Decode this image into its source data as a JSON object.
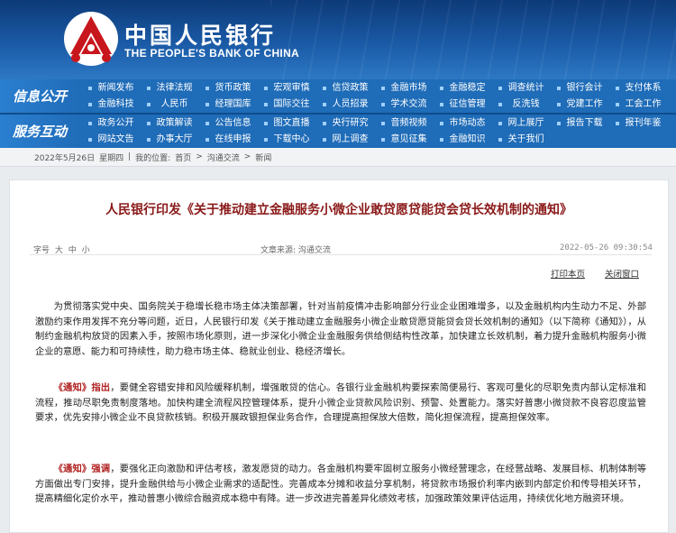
{
  "header": {
    "bank_name_cn": "中国人民银行",
    "bank_name_en": "THE PEOPLE'S BANK OF CHINA",
    "logo_icon": "pboc-logo-icon",
    "color_primary": "#1f6cb8",
    "color_title": "#8b1a1a"
  },
  "nav": {
    "info_label": "信息公开",
    "service_label": "服务互动",
    "rows": [
      [
        "新闻发布",
        "法律法规",
        "货币政策",
        "宏观审慎",
        "信贷政策",
        "金融市场",
        "金融稳定",
        "调查统计",
        "银行会计",
        "支付体系"
      ],
      [
        "金融科技",
        "人民币",
        "经理国库",
        "国际交往",
        "人员招录",
        "学术交流",
        "征信管理",
        "反洗钱",
        "党建工作",
        "工会工作"
      ],
      [
        "政务公开",
        "政策解读",
        "公告信息",
        "图文直播",
        "央行研究",
        "音频视频",
        "市场动态",
        "网上展厅",
        "报告下载",
        "报刊年鉴"
      ],
      [
        "网站文告",
        "办事大厅",
        "在线申报",
        "下载中心",
        "网上调查",
        "意见征集",
        "金融知识",
        "关于我们"
      ]
    ]
  },
  "breadcrumb": {
    "date": "2022年5月26日",
    "weekday": "星期四",
    "location_label": "我的位置:",
    "items": [
      "首页",
      "沟通交流",
      "新闻"
    ],
    "separator": ">"
  },
  "article": {
    "title": "人民银行印发《关于推动建立金融服务小微企业敢贷愿贷能贷会贷长效机制的通知》",
    "font_size_label": "字号",
    "font_sizes": [
      "大",
      "中",
      "小"
    ],
    "source_label": "文章来源:",
    "source": "沟通交流",
    "datetime": "2022-05-26  09:30:54",
    "print_label": "打印本页",
    "close_label": "关闭窗口",
    "paragraphs": [
      {
        "highlight": "",
        "text": "为贯彻落实党中央、国务院关于稳增长稳市场主体决策部署，针对当前疫情冲击影响部分行业企业困难增多，以及金融机构内生动力不足、外部激励约束作用发挥不充分等问题，近日，人民银行印发《关于推动建立金融服务小微企业敢贷愿贷能贷会贷长效机制的通知》（以下简称《通知》），从制约金融机构放贷的因素入手，按照市场化原则，进一步深化小微企业金融服务供给侧结构性改革，加快建立长效机制，着力提升金融机构服务小微企业的意愿、能力和可持续性，助力稳市场主体、稳就业创业、稳经济增长。"
      },
      {
        "highlight": "《通知》指出",
        "text": "，要健全容错安排和风险缓释机制，增强敢贷的信心。各银行业金融机构要探索简便易行、客观可量化的尽职免责内部认定标准和流程，推动尽职免责制度落地。加快构建全流程风控管理体系，提升小微企业贷款风险识别、预警、处置能力。落实好普惠小微贷款不良容忍度监管要求，优先安排小微企业不良贷款核销。积极开展政银担保业务合作，合理提高担保放大倍数，简化担保流程，提高担保效率。"
      },
      {
        "highlight": "《通知》强调",
        "text": "，要强化正向激励和评估考核，激发愿贷的动力。各金融机构要牢固树立服务小微经营理念，在经营战略、发展目标、机制体制等方面做出专门安排，提升金融供给与小微企业需求的适配性。完善成本分摊和收益分享机制，将贷款市场报价利率内嵌到内部定价和传导相关环节，提高精细化定价水平，推动普惠小微综合融资成本稳中有降。进一步改进完善差异化绩效考核，加强政策效果评估运用，持续优化地方融资环境。"
      }
    ]
  }
}
